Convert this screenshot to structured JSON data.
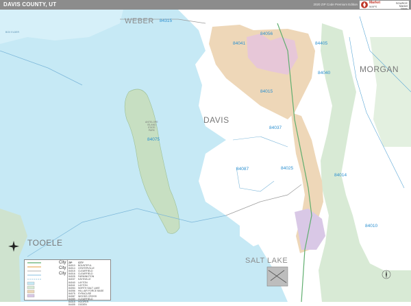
{
  "header": {
    "title": "DAVIS COUNTY, UT",
    "edition": "2020 ZIP Code Premium Edition",
    "logo": {
      "line1": "Market",
      "line2": "MAPS",
      "right1": "SOURCE",
      "right2": "Market",
      "right3": "Maps"
    }
  },
  "counties": {
    "weber": "WEBER",
    "davis": "DAVIS",
    "morgan": "MORGAN",
    "tooele": "TOOELE",
    "salt_lake": "SALT LAKE"
  },
  "zips": {
    "z84315": "84315",
    "z84056": "84056",
    "z84041": "84041",
    "z84405": "84405",
    "z84015": "84015",
    "z84040": "84040",
    "z84075": "84075",
    "z84037": "84037",
    "z84087": "84087",
    "z84025": "84025",
    "z84014": "84014",
    "z84010": "84010"
  },
  "places": {
    "box_elder": "BOX ELDER",
    "antelope": "ANTELOPE\nISLAND\nSTATE\nPARK"
  },
  "legend": {
    "city_label_1": "City",
    "city_label_2": "City",
    "city_label_3": "City",
    "zip_header": "ZIP",
    "city_header": "CITY",
    "zip_col": "84010\n84014\n84015\n84016\n84025\n84037\n84040\n84041\n84054\n84056\n84075\n84087\n84089\n84315\n84405",
    "city_col": "BOUNTIFUL\nCENTERVILLE\nCLEARFIELD\nCLEARFIELD\nFARMINGTON\nKAYSVILLE\nLAYTON\nLAYTON\nNORTH SALT LAKE\nHILL AIR FORCE BASE\nSYRACUSE\nWOODS CROSS\nCLEARFIELD\nHOOPER\nOGDEN"
  }
}
